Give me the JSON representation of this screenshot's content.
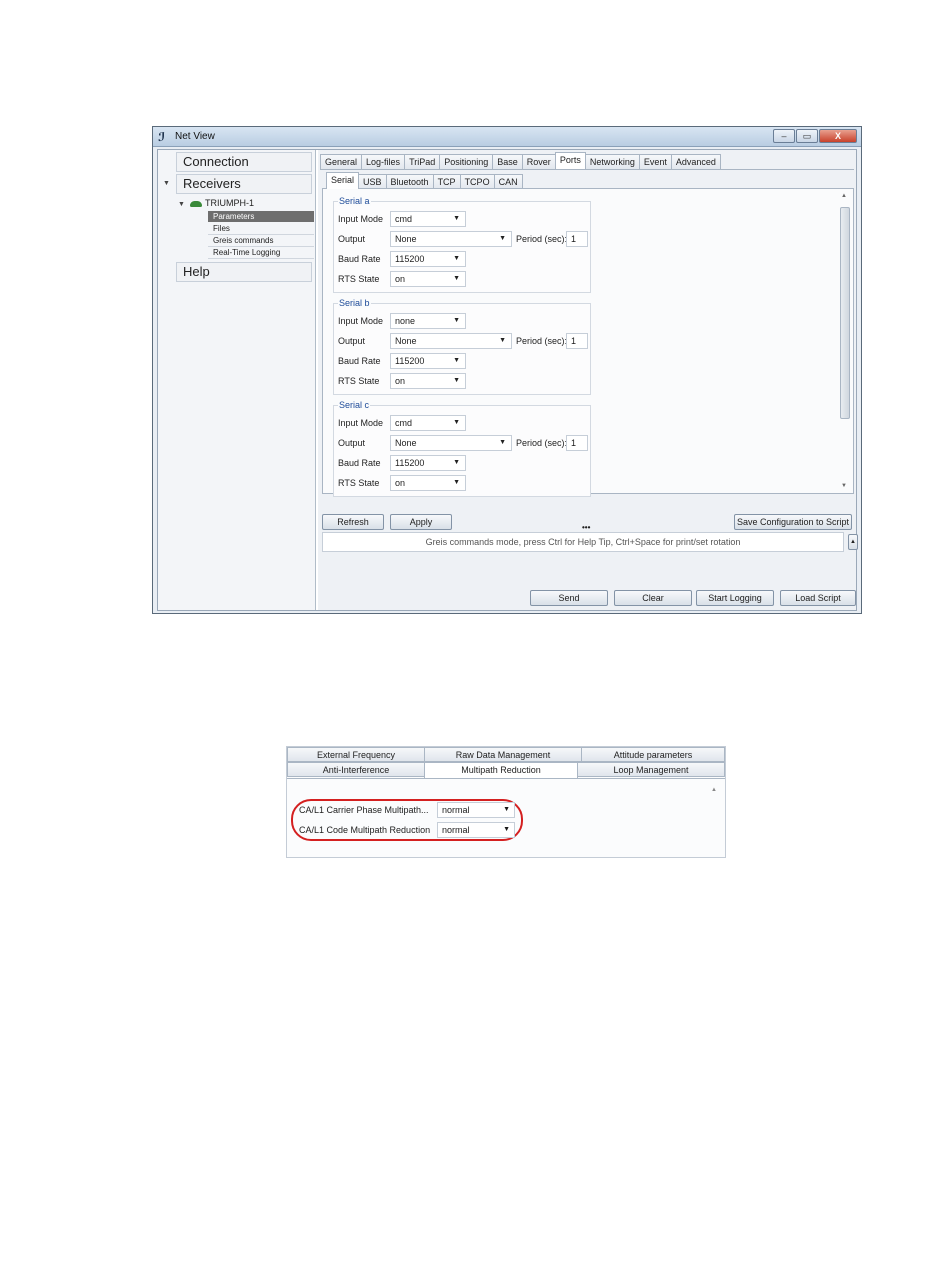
{
  "window": {
    "title": "Net View",
    "controls": [
      "–",
      "▭",
      "X"
    ]
  },
  "nav": {
    "connection": "Connection",
    "receivers": "Receivers",
    "receiver_name": "TRIUMPH-1",
    "items": [
      "Parameters",
      "Files",
      "Greis commands",
      "Real-Time Logging"
    ],
    "help": "Help"
  },
  "main_tabs": [
    "General",
    "Log-files",
    "TriPad",
    "Positioning",
    "Base",
    "Rover",
    "Ports",
    "Networking",
    "Event",
    "Advanced"
  ],
  "main_tab_active": "Ports",
  "sub_tabs": [
    "Serial",
    "USB",
    "Bluetooth",
    "TCP",
    "TCPO",
    "CAN"
  ],
  "sub_tab_active": "Serial",
  "labels": {
    "input_mode": "Input Mode",
    "output": "Output",
    "period": "Period (sec):",
    "baud_rate": "Baud Rate",
    "rts_state": "RTS State"
  },
  "serial_groups": [
    {
      "title": "Serial a",
      "input_mode": "cmd",
      "output": "None",
      "period": "1",
      "baud_rate": "115200",
      "rts_state": "on"
    },
    {
      "title": "Serial b",
      "input_mode": "none",
      "output": "None",
      "period": "1",
      "baud_rate": "115200",
      "rts_state": "on"
    },
    {
      "title": "Serial c",
      "input_mode": "cmd",
      "output": "None",
      "period": "1",
      "baud_rate": "115200",
      "rts_state": "on"
    }
  ],
  "buttons": {
    "refresh": "Refresh",
    "apply": "Apply",
    "save_config": "Save Configuration to Script",
    "send": "Send",
    "clear": "Clear",
    "start_logging": "Start Logging",
    "load_script": "Load Script"
  },
  "command_hint": "Greis commands mode, press Ctrl for Help Tip, Ctrl+Space for print/set rotation",
  "splitter_glyph": "•••",
  "advanced_panel": {
    "tabs_row1": [
      "External Frequency",
      "Raw Data Management",
      "Attitude parameters"
    ],
    "tabs_row2": [
      "Anti-Interference",
      "Multipath Reduction",
      "Loop Management"
    ],
    "active_tab": "Multipath Reduction",
    "fields": [
      {
        "label": "CA/L1 Carrier Phase Multipath...",
        "value": "normal"
      },
      {
        "label": "CA/L1 Code Multipath Reduction",
        "value": "normal"
      }
    ],
    "highlight_color": "#d42020"
  }
}
